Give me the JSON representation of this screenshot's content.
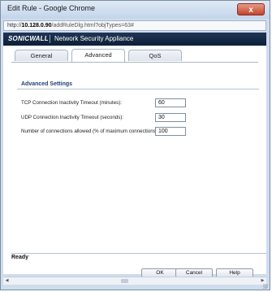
{
  "window": {
    "title": "Edit Rule - Google Chrome",
    "close_label": "x"
  },
  "address": {
    "prefix": "http://",
    "host": "10.128.0.90",
    "path": "/addRuleDlg.html?objTypes=63#"
  },
  "brand": {
    "logo": "SONICWALL",
    "product": "Network Security Appliance"
  },
  "tabs": [
    {
      "label": "General",
      "active": false
    },
    {
      "label": "Advanced",
      "active": true
    },
    {
      "label": "QoS",
      "active": false
    }
  ],
  "section": {
    "title": "Advanced Settings"
  },
  "fields": [
    {
      "label": "TCP Connection Inactivity Timeout (minutes):",
      "value": "60"
    },
    {
      "label": "UDP Connection Inactivity Timeout (seconds):",
      "value": "30"
    },
    {
      "label": "Number of connections allowed (% of maximum connections):",
      "value": "100"
    }
  ],
  "status": {
    "text": "Ready"
  },
  "buttons": {
    "ok": "OK",
    "cancel": "Cancel",
    "help": "Help"
  },
  "scrollbar": {
    "left_arrow": "◀",
    "right_arrow": "▶"
  },
  "colors": {
    "brand_bar": "#14294a",
    "section_title": "#1e3f73",
    "window_frame": "#cfdcec"
  }
}
